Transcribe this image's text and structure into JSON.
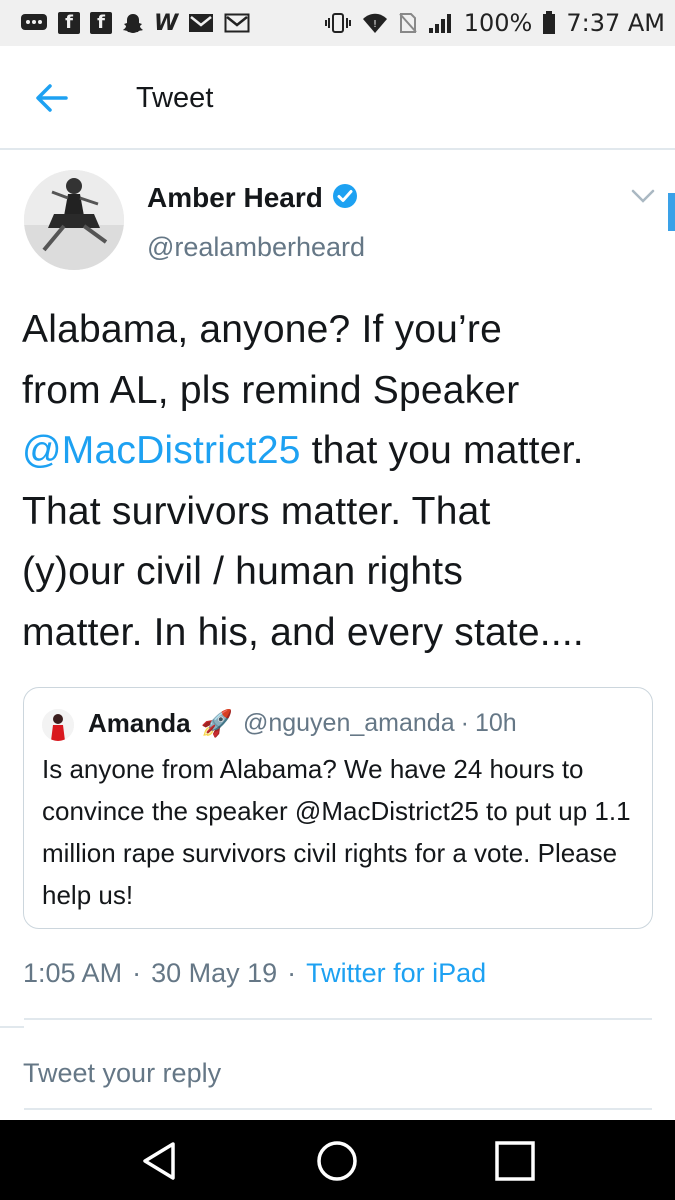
{
  "status_bar": {
    "battery": "100%",
    "time": "7:37 AM",
    "left_icons": [
      "chat-icon",
      "facebook-icon",
      "facebook-icon",
      "snapchat-icon",
      "w-icon",
      "gmail-icon",
      "gmail-outline-icon"
    ],
    "right_icons": [
      "vibrate-icon",
      "wifi-icon",
      "sim-off-icon",
      "signal-icon",
      "battery-icon"
    ]
  },
  "header": {
    "title": "Tweet",
    "back_icon": "arrow-left-icon"
  },
  "tweet": {
    "author_name": "Amber Heard",
    "author_handle": "@realamberheard",
    "verified": true,
    "body_lines": [
      {
        "text": "Alabama, anyone? If you’re"
      },
      {
        "text": "from AL, pls remind Speaker"
      },
      {
        "mention": "@MacDistrict25",
        "text": " that you matter."
      },
      {
        "text": "That survivors matter. That"
      },
      {
        "text": "(y)our civil / human rights"
      },
      {
        "text": "matter. In his, and every state...."
      }
    ],
    "time": "1:05 AM",
    "date": "30 May 19",
    "source": "Twitter for iPad",
    "separator": "·"
  },
  "quoted_tweet": {
    "author_name": "Amanda",
    "emoji": "🚀",
    "author_handle": "@nguyen_amanda",
    "time": "10h",
    "separator": "·",
    "text": "Is anyone from Alabama? We have 24 hours to convince the speaker @MacDistrict25 to put up 1.1 million rape survivors civil rights for a vote. Please help us!"
  },
  "reply": {
    "placeholder": "Tweet your reply"
  },
  "colors": {
    "accent": "#1da1f2",
    "secondary_text": "#657786",
    "border": "#e1e8ed"
  }
}
